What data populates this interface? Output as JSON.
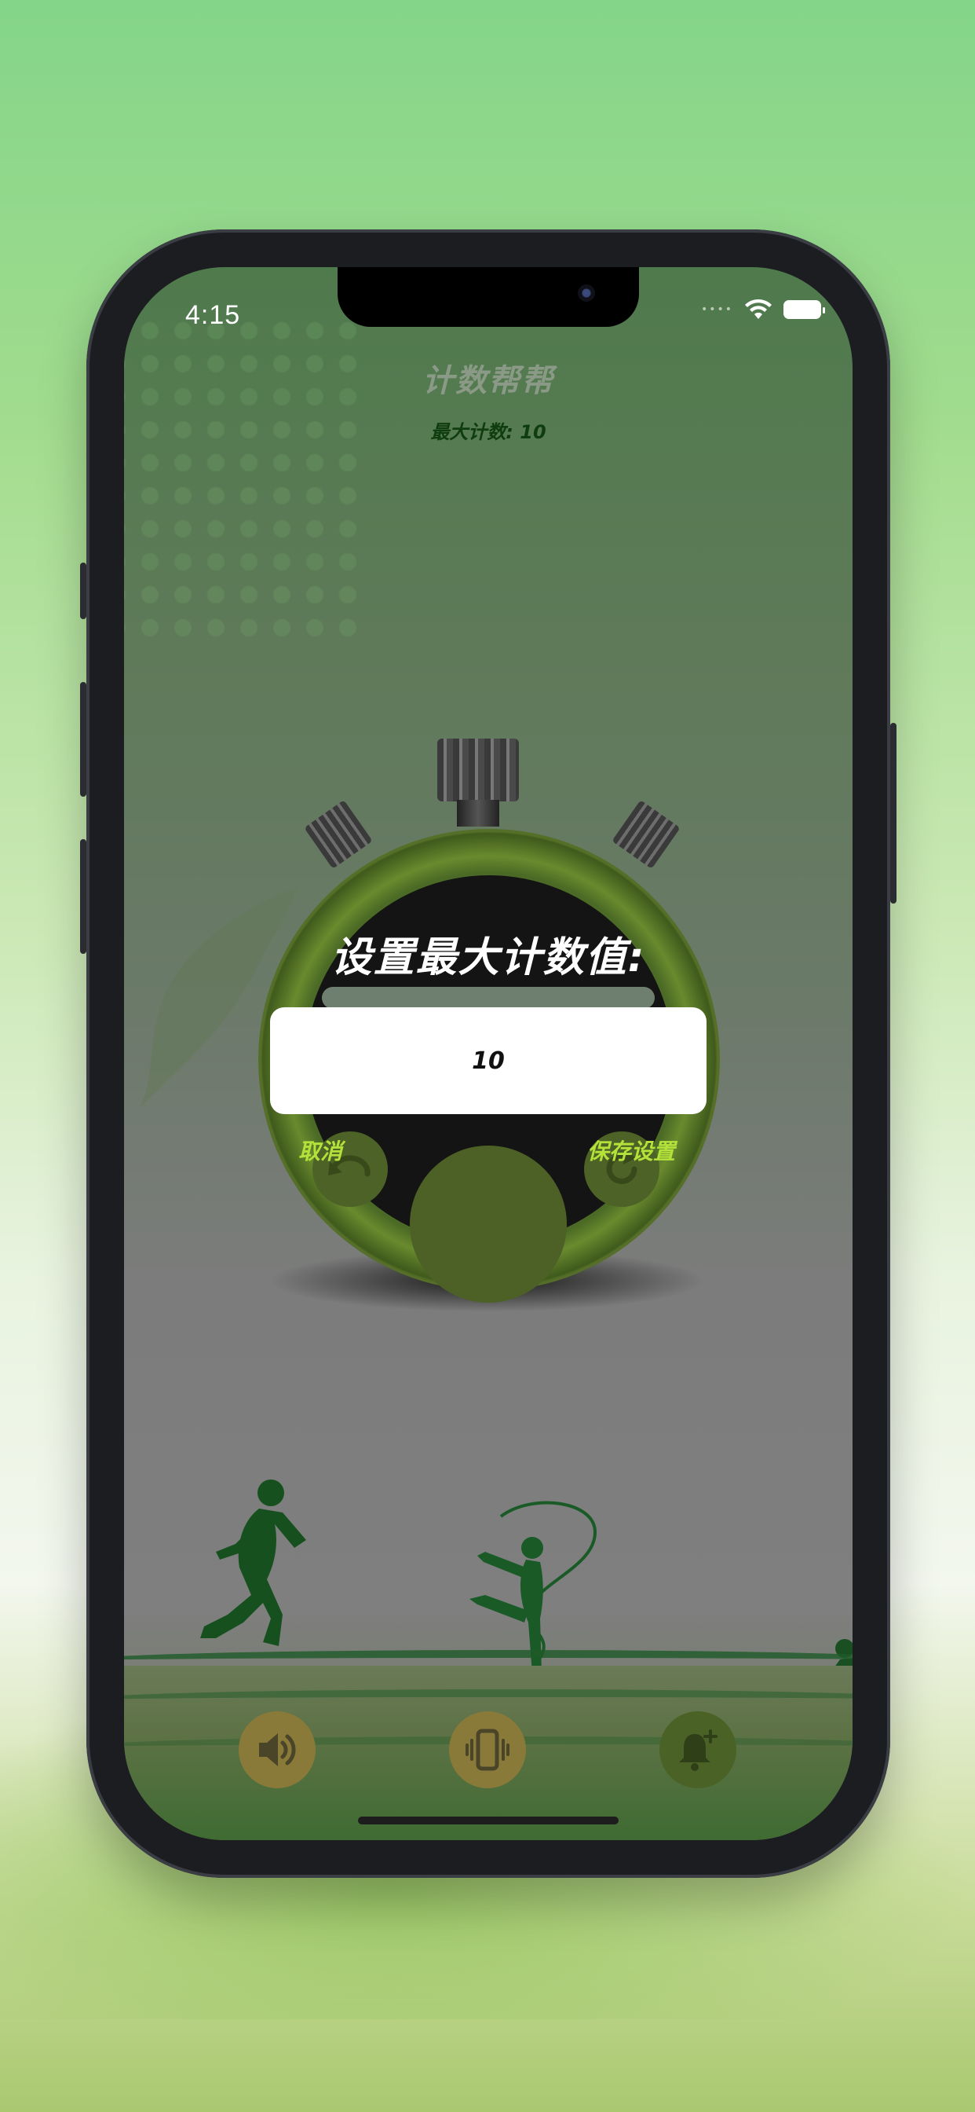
{
  "status_bar": {
    "time": "4:15",
    "dots": "••••",
    "icons": [
      "wifi-icon",
      "battery-icon"
    ]
  },
  "header": {
    "app_title": "计数帮帮",
    "max_count_label": "最大计数: 10"
  },
  "dialog": {
    "title": "设置最大计数值:",
    "input_value": "10",
    "cancel_label": "取消",
    "save_label": "保存设置"
  },
  "stopwatch": {
    "left_button_icon": "undo-icon",
    "right_button_icon": "refresh-icon"
  },
  "toolbar": {
    "items": [
      {
        "icon": "speaker-icon",
        "color": "#8a7a3a"
      },
      {
        "icon": "vibrate-icon",
        "color": "#8a7a3a"
      },
      {
        "icon": "bell-plus-icon",
        "color": "#4a6226"
      }
    ]
  },
  "colors": {
    "accent": "#b4e23a",
    "screen_top": "#4f7a4c",
    "screen_bottom": "#7f7f7f"
  }
}
